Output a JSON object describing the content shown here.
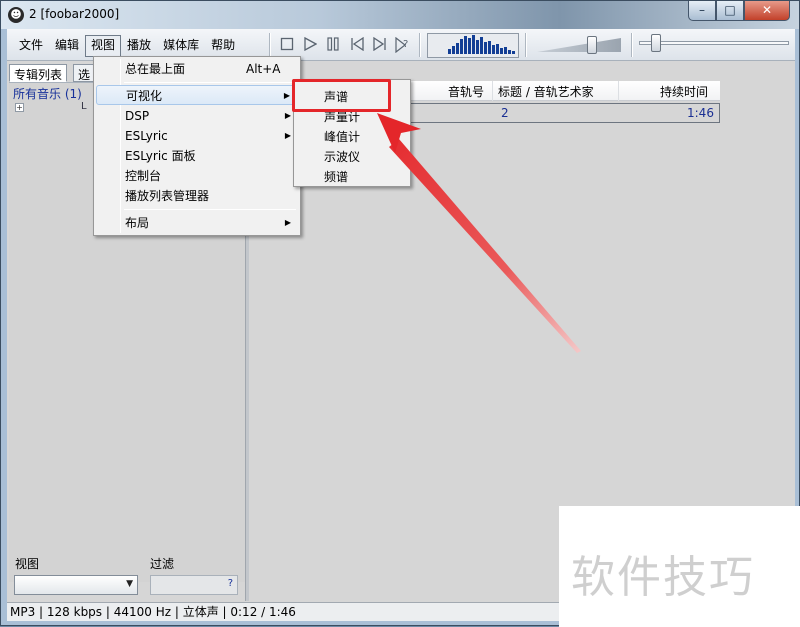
{
  "window": {
    "title": "2  [foobar2000]",
    "minimize_glyph": "–",
    "maximize_glyph": "□",
    "close_glyph": "✕"
  },
  "menubar": {
    "items": [
      "文件",
      "编辑",
      "视图",
      "播放",
      "媒体库",
      "帮助"
    ],
    "active_index": 2
  },
  "toolbar": {
    "buttons": [
      "stop-icon",
      "play-icon",
      "pause-icon",
      "previous-icon",
      "next-icon",
      "random-icon"
    ]
  },
  "visualizer": {
    "levels": [
      0.25,
      0.4,
      0.55,
      0.75,
      0.9,
      0.8,
      0.95,
      0.7,
      0.85,
      0.6,
      0.65,
      0.45,
      0.5,
      0.3,
      0.35,
      0.2,
      0.15
    ]
  },
  "volume": {
    "level": 0.7
  },
  "seek": {
    "position": 0.04
  },
  "left_panel": {
    "tabs": [
      "专辑列表",
      "选择"
    ],
    "tree_root": "所有音乐 (1)",
    "tree_child": "L",
    "view_label": "视图",
    "filter_label": "过滤",
    "filter_help": "?"
  },
  "playlist": {
    "columns": [
      "音轨号",
      "标题 / 音轨艺术家",
      "持续时间"
    ],
    "rows": [
      {
        "track": "2",
        "duration": "1:46"
      }
    ]
  },
  "status_bar": {
    "text": "MP3 | 128 kbps | 44100 Hz | 立体声 | 0:12 / 1:46"
  },
  "view_menu": {
    "items": [
      {
        "label": "总在最上面",
        "shortcut": "Alt+A"
      },
      {
        "label": "可视化",
        "submenu": true,
        "highlighted": true
      },
      {
        "label": "DSP",
        "submenu": true
      },
      {
        "label": "ESLyric",
        "submenu": true
      },
      {
        "label": "ESLyric 面板"
      },
      {
        "label": "控制台"
      },
      {
        "label": "播放列表管理器"
      },
      {
        "label": "布局",
        "submenu": true
      }
    ],
    "submenu_arrow": "▶"
  },
  "visualization_submenu": {
    "items": [
      "声谱",
      "声量计",
      "峰值计",
      "示波仪",
      "频谱"
    ]
  },
  "watermark": {
    "text": "软件技巧"
  },
  "colors": {
    "highlight_box": "#e4262a",
    "arrow": "#e4262a",
    "visualizer_bar": "#123e95",
    "link_text": "#17319a"
  }
}
